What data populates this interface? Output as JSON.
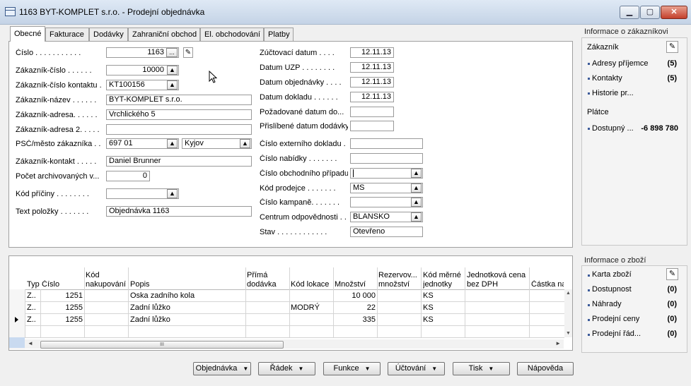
{
  "window": {
    "title": "1163 BYT-KOMPLET s.r.o. - Prodejní objednávka",
    "min": "▁",
    "max": "▢",
    "close": "✕"
  },
  "tabs": [
    "Obecné",
    "Fakturace",
    "Dodávky",
    "Zahraniční obchod",
    "El. obchodování",
    "Platby"
  ],
  "general": {
    "left": [
      {
        "label": "Číslo . . . . . . . . . . .",
        "value": "1163"
      },
      {
        "label": "Zákazník-číslo . . . . . .",
        "value": "10000"
      },
      {
        "label": "Zákazník-číslo kontaktu .",
        "value": "KT100156"
      },
      {
        "label": "Zákazník-název . . . . . .",
        "value": "BYT-KOMPLET s.r.o."
      },
      {
        "label": "Zákazník-adresa. . . . . .",
        "value": "Vrchlického 5"
      },
      {
        "label": "Zákazník-adresa 2. . . . .",
        "value": ""
      },
      {
        "label": "PSČ/město zákazníka . .",
        "value": "697 01",
        "value2": "Kyjov"
      },
      {
        "label": "Zákazník-kontakt . . . . .",
        "value": "Daniel Brunner"
      },
      {
        "label": "Počet archivovaných v...",
        "value": "0"
      },
      {
        "label": "Kód příčiny . . . . . . . .",
        "value": ""
      },
      {
        "label": "Text položky . . . . . . .",
        "value": "Objednávka 1163"
      }
    ],
    "right": [
      {
        "label": "Zúčtovací datum . . . .",
        "value": "12.11.13"
      },
      {
        "label": "Datum UZP . . . . . . . .",
        "value": "12.11.13"
      },
      {
        "label": "Datum objednávky . . . .",
        "value": "12.11.13"
      },
      {
        "label": "Datum dokladu . . . . . .",
        "value": "12.11.13"
      },
      {
        "label": "Požadované datum do...",
        "value": ""
      },
      {
        "label": "Přislíbené datum dodávky",
        "value": ""
      },
      {
        "label": "Číslo externího dokladu .",
        "value": ""
      },
      {
        "label": "Číslo nabídky . . . . . . .",
        "value": ""
      },
      {
        "label": "Číslo obchodního případu",
        "value": ""
      },
      {
        "label": "Kód prodejce . . . . . . .",
        "value": "MS"
      },
      {
        "label": "Číslo kampaně. . . . . . .",
        "value": ""
      },
      {
        "label": "Centrum odpovědnosti . .",
        "value": "BLANSKO"
      },
      {
        "label": "Stav . . . . . . . . . . . .",
        "value": "Otevřeno"
      }
    ],
    "ellipsis": "..."
  },
  "customer_factbox": {
    "title": "Informace o zákazníkovi",
    "section1": "Zákazník",
    "items": [
      {
        "label": "Adresy příjemce",
        "count": "(5)"
      },
      {
        "label": "Kontakty",
        "count": "(5)"
      },
      {
        "label": "Historie pr...",
        "count": ""
      }
    ],
    "section2": "Plátce",
    "available_label": "Dostupný ...",
    "available_value": "-6 898 780"
  },
  "item_factbox": {
    "title": "Informace o zboží",
    "items": [
      {
        "label": "Karta zboží",
        "count": ""
      },
      {
        "label": "Dostupnost",
        "count": "(0)"
      },
      {
        "label": "Náhrady",
        "count": "(0)"
      },
      {
        "label": "Prodejní ceny",
        "count": "(0)"
      },
      {
        "label": "Prodejní řád...",
        "count": "(0)"
      }
    ]
  },
  "lines": {
    "columns": [
      "Typ",
      "Číslo",
      "Kód nakupování",
      "Popis",
      "Přímá dodávka",
      "Kód lokace",
      "Množství",
      "Rezervov... množství",
      "Kód měrné jednotky",
      "Jednotková cena bez DPH",
      "Částka na"
    ],
    "rows": [
      {
        "type": "Z..",
        "no": "1251",
        "desc": "Oska zadního kola",
        "loc": "",
        "qty": "10 000",
        "uom": "KS"
      },
      {
        "type": "Z..",
        "no": "1255",
        "desc": "Zadní lůžko",
        "loc": "MODRÝ",
        "qty": "22",
        "uom": "KS"
      },
      {
        "type": "Z..",
        "no": "1255",
        "desc": "Zadní lůžko",
        "loc": "",
        "qty": "335",
        "uom": "KS"
      }
    ],
    "scroll_grip": "III"
  },
  "buttons": [
    "Objednávka",
    "Řádek",
    "Funkce",
    "Účtování",
    "Tisk",
    "Nápověda"
  ]
}
